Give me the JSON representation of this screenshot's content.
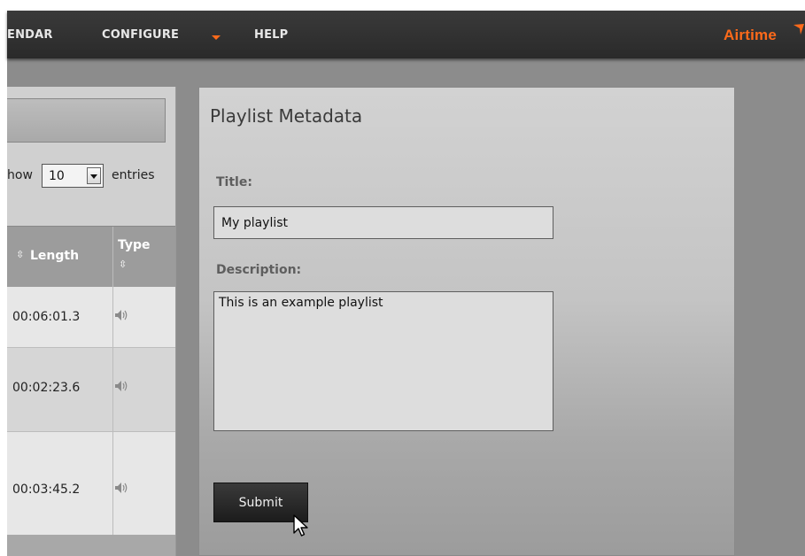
{
  "nav": {
    "items": [
      {
        "label": "ENDAR"
      },
      {
        "label": "CONFIGURE"
      },
      {
        "label": "HELP"
      }
    ],
    "logo": "Airtime",
    "accent_color": "#ff6a1a"
  },
  "library": {
    "show_label": "how",
    "entries_value": "10",
    "entries_label": "entries",
    "columns": {
      "length": "Length",
      "type": "Type"
    },
    "rows": [
      {
        "length": "00:06:01.3",
        "type_icon": "speaker-icon"
      },
      {
        "length": "00:02:23.6",
        "type_icon": "speaker-icon"
      },
      {
        "length": "00:03:45.2",
        "type_icon": "speaker-icon"
      }
    ]
  },
  "metadata": {
    "heading": "Playlist Metadata",
    "title_label": "Title:",
    "title_value": "My playlist",
    "description_label": "Description:",
    "description_value": "This is an example playlist",
    "submit_label": "Submit"
  },
  "icons": {
    "sort": "sort-icon",
    "speaker": "speaker-icon",
    "dropdown": "chevron-down-icon",
    "cursor": "mouse-cursor-icon"
  }
}
